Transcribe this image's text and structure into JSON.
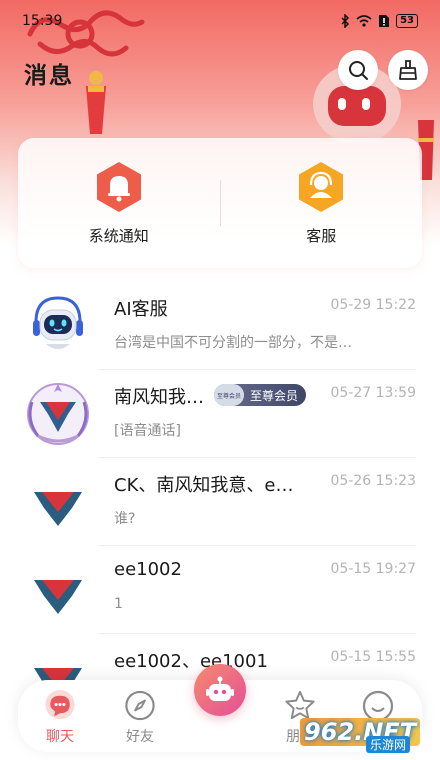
{
  "status_bar": {
    "time": "15:39",
    "battery": "53"
  },
  "header": {
    "title": "消息",
    "search_icon": "search-icon",
    "clean_icon": "broom-icon"
  },
  "quick_actions": [
    {
      "label": "系统通知",
      "icon": "bell-icon",
      "color": "#ee5d4a"
    },
    {
      "label": "客服",
      "icon": "headset-agent-icon",
      "color": "#f5a623"
    }
  ],
  "chats": [
    {
      "name": "AI客服",
      "time": "05-29 15:22",
      "preview": "台湾是中国不可分割的一部分，不是…",
      "avatar": "robot-avatar-icon"
    },
    {
      "name": "南风知我…",
      "time": "05-27 13:59",
      "preview": "[语音通话]",
      "badge": "至尊会员",
      "badge_emblem": "至尊会员",
      "avatar": "emblem-avatar-icon"
    },
    {
      "name": "CK、南风知我意、e…",
      "time": "05-26 15:23",
      "preview": "谁?",
      "avatar": "emblem-avatar-icon"
    },
    {
      "name": "ee1002",
      "time": "05-15 19:27",
      "preview": "1",
      "avatar": "emblem-avatar-icon"
    },
    {
      "name": "ee1002、ee1001",
      "time": "05-15 15:55",
      "preview": "",
      "avatar": "emblem-avatar-icon"
    }
  ],
  "tabs": [
    {
      "label": "聊天",
      "icon": "chat-bubble-icon",
      "active": true
    },
    {
      "label": "好友",
      "icon": "compass-icon",
      "active": false
    },
    {
      "label": "朋友",
      "icon": "star-icon",
      "active": false
    },
    {
      "label": "",
      "icon": "smile-icon",
      "active": false
    }
  ],
  "center_button": {
    "icon": "robot-icon"
  },
  "watermark": {
    "logo": "962.NET",
    "sub": "乐游网"
  },
  "colors": {
    "accent": "#e9585c",
    "hero_top": "#f26a63",
    "time_text": "#b4b4b4"
  }
}
